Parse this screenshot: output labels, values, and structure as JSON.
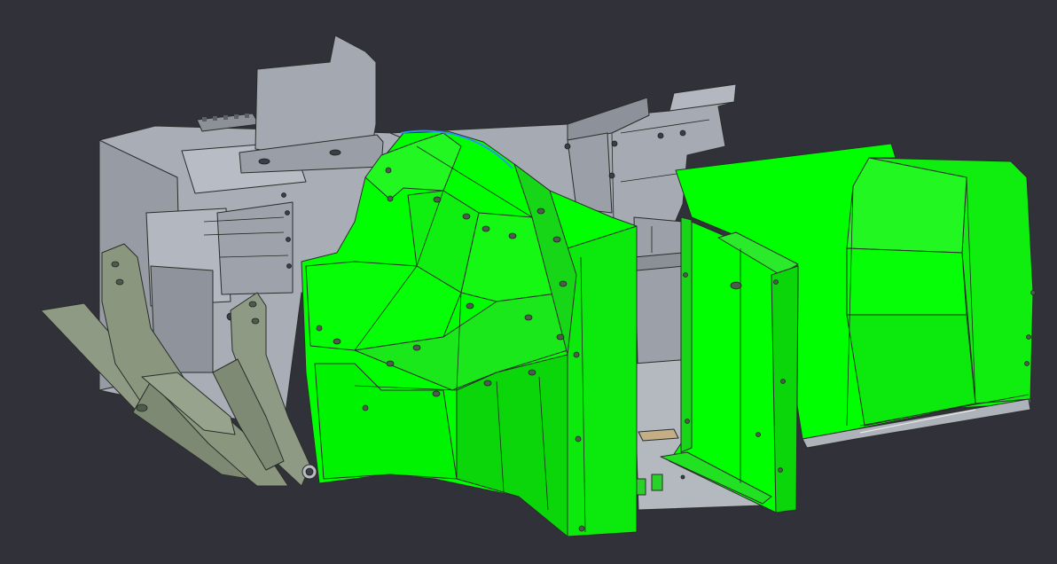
{
  "viewport": {
    "background": "#313139",
    "highlight_color": "#00ff00",
    "part_color": "#a9adb5",
    "bracket_color": "#8f9a84",
    "selection_edge_color": "#2f8fff"
  },
  "scene": {
    "model": "sheet-metal-assembly",
    "parts": [
      {
        "id": "rear-gray-frame",
        "highlighted": false
      },
      {
        "id": "left-tab-panel",
        "highlighted": false
      },
      {
        "id": "right-rear-panel",
        "highlighted": false
      },
      {
        "id": "floor-plate",
        "highlighted": false
      },
      {
        "id": "olive-mount-brackets",
        "highlighted": false
      },
      {
        "id": "center-curved-shroud",
        "highlighted": true
      },
      {
        "id": "right-hood-panel",
        "highlighted": true
      },
      {
        "id": "right-door-panel",
        "highlighted": true
      }
    ]
  }
}
